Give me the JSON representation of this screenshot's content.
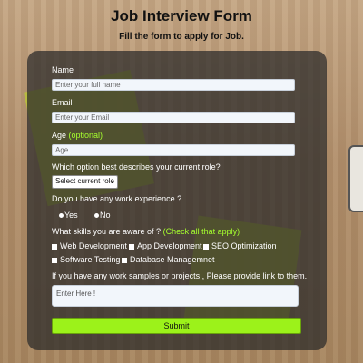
{
  "header": {
    "title": "Job Interview Form",
    "subtitle": "Fill the form to apply for Job."
  },
  "form": {
    "name": {
      "label": "Name",
      "placeholder": "Enter your full name"
    },
    "email": {
      "label": "Email",
      "placeholder": "Enter your Email"
    },
    "age": {
      "label": "Age",
      "hint": "(optional)",
      "placeholder": "Age"
    },
    "role": {
      "label": "Which option best describes your current role?",
      "selected": "Select current role"
    },
    "experience": {
      "label": "Do you have any work experience ?",
      "options": [
        "Yes",
        "No"
      ]
    },
    "skills": {
      "label": "What skills you are aware of ?",
      "hint": "(Check all that apply)",
      "options": [
        "Web Development",
        "App Development",
        "SEO Optimization",
        "Software Testing",
        "Database Managemnet"
      ]
    },
    "samples": {
      "label": "If you have any work samples or projects , Please provide link to them.",
      "placeholder": "Enter Here !"
    },
    "submit_label": "Submit"
  },
  "colors": {
    "accent": "#9cf21a",
    "hint": "#a6ff2e",
    "panel": "#282828"
  }
}
